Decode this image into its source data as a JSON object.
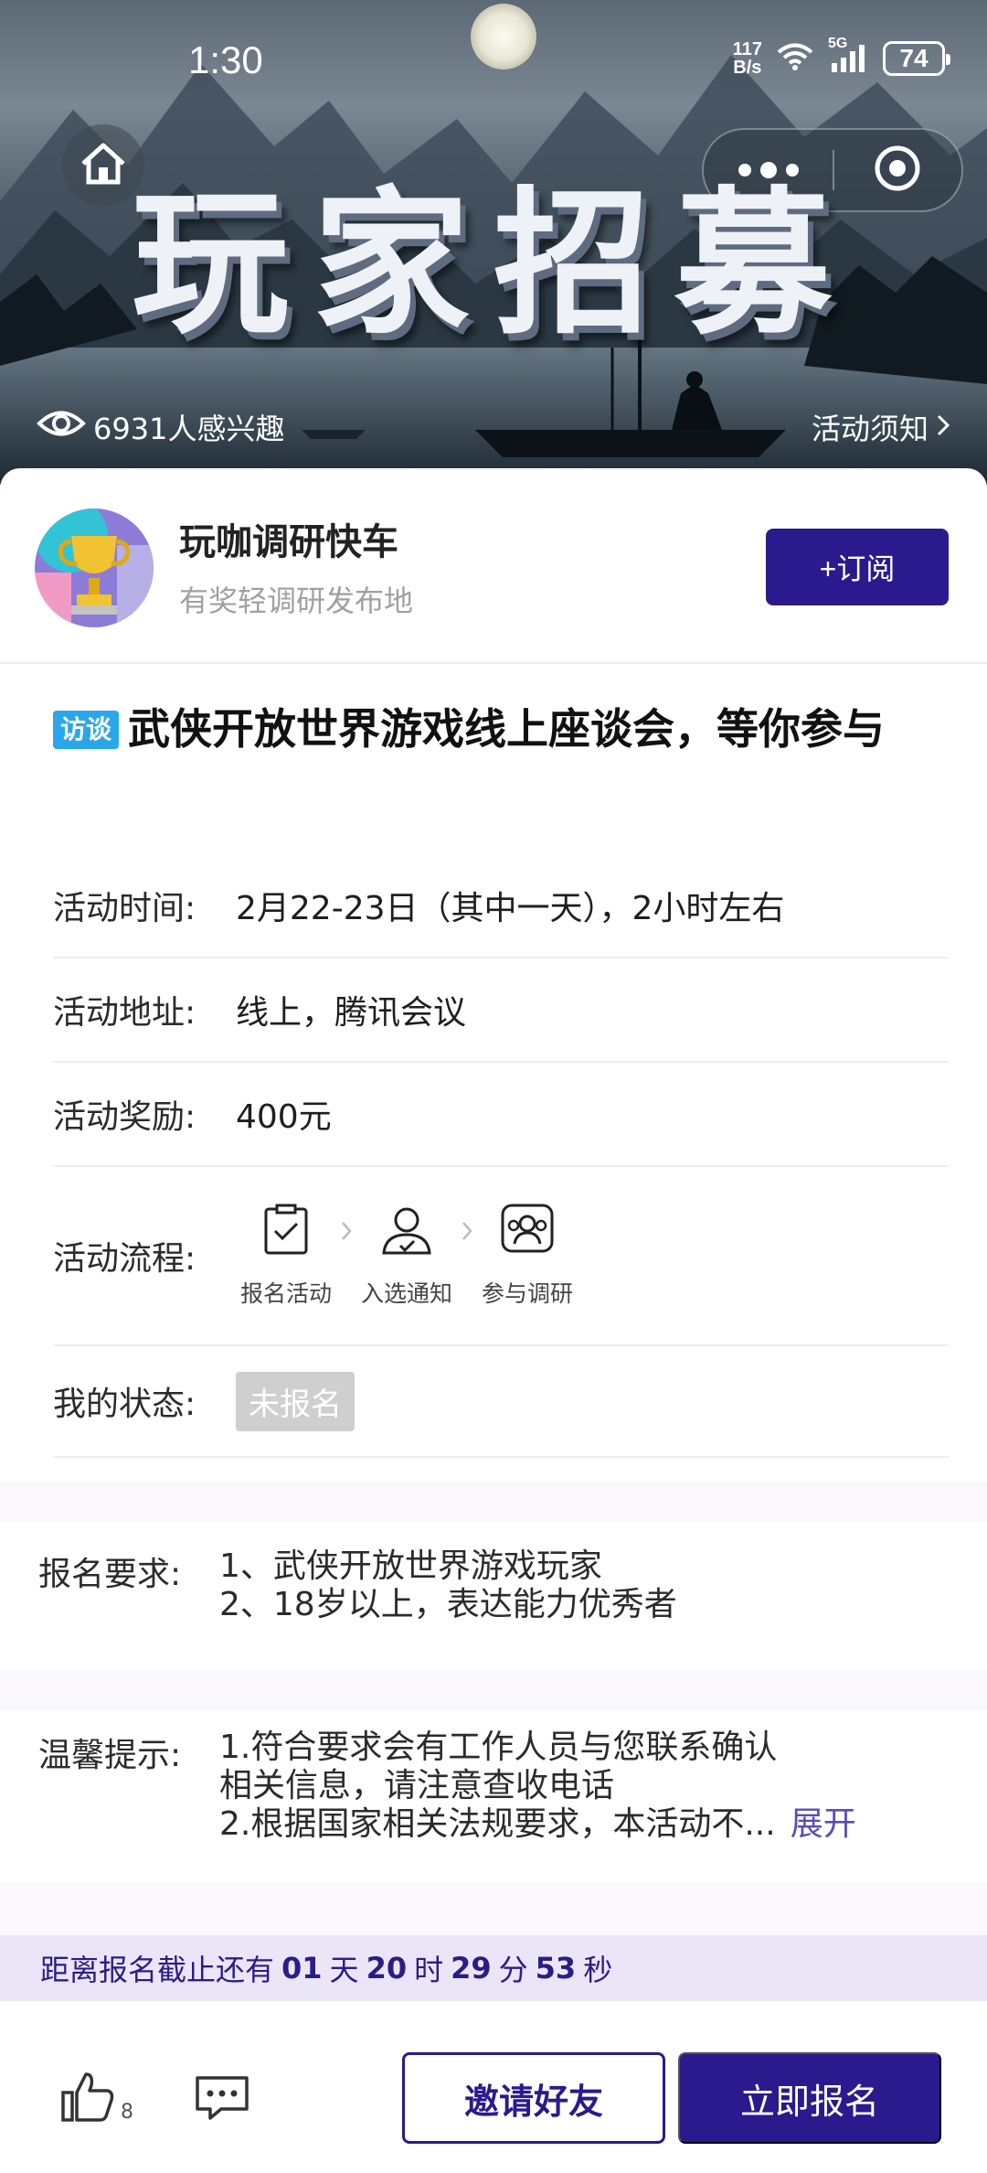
{
  "status_bar": {
    "time": "1:30",
    "net_speed_value": "117",
    "net_speed_unit": "B/s",
    "network": "5G",
    "battery": "74"
  },
  "banner": {
    "title": "玩家招募",
    "interest_text": "6931人感兴趣",
    "notice_link": "活动须知"
  },
  "publisher": {
    "name": "玩咖调研快车",
    "description": "有奖轻调研发布地",
    "subscribe_label": "+订阅"
  },
  "activity": {
    "tag": "访谈",
    "title": "武侠开放世界游戏线上座谈会，等你参与",
    "time_label": "活动时间:",
    "time_value": "2月22-23日（其中一天），2小时左右",
    "address_label": "活动地址:",
    "address_value": "线上，腾讯会议",
    "reward_label": "活动奖励:",
    "reward_value": "400元",
    "process_label": "活动流程:",
    "steps": [
      "报名活动",
      "入选通知",
      "参与调研"
    ],
    "status_label": "我的状态:",
    "status_value": "未报名"
  },
  "requirements": {
    "label": "报名要求:",
    "lines": [
      "1、武侠开放世界游戏玩家",
      "2、18岁以上，表达能力优秀者"
    ]
  },
  "tips": {
    "label": "温馨提示:",
    "lines": [
      "1.符合要求会有工作人员与您联系确认",
      "相关信息，请注意查收电话",
      "2.根据国家相关法规要求，本活动不..."
    ],
    "expand_label": "展开"
  },
  "deadline": {
    "prefix": "距离报名截止还有",
    "days": "01",
    "days_unit": "天",
    "hours": "20",
    "hours_unit": "时",
    "minutes": "29",
    "minutes_unit": "分",
    "seconds": "53",
    "seconds_unit": "秒"
  },
  "bottom": {
    "like_count": "8",
    "invite_label": "邀请好友",
    "signup_label": "立即报名"
  },
  "colors": {
    "brand": "#2a1a8e",
    "tag": "#2aa7ea",
    "deadline_bg": "#ebe5f8",
    "status_badge": "#cfcfcf"
  }
}
